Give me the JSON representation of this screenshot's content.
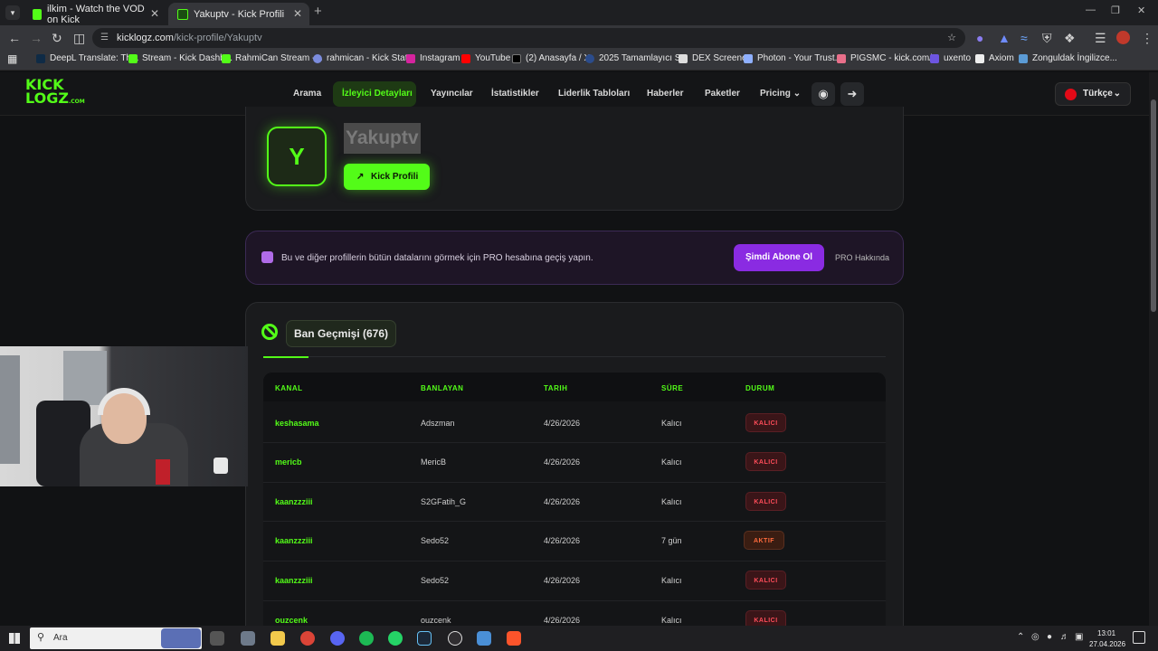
{
  "browser": {
    "tabs": [
      {
        "title": "ilkim - Watch the VOD on Kick",
        "active": false
      },
      {
        "title": "Yakuptv - Kick Profili",
        "active": true
      }
    ],
    "new_tab": "+",
    "url_host": "kicklogz.com",
    "url_path": "/kick-profile/Yakuptv",
    "bookmarks": [
      "DeepL Translate: Th...",
      "Stream - Kick Dashb...",
      "RahmiCan Stream -...",
      "rahmican - Kick Stat...",
      "Instagram",
      "YouTube",
      "(2) Anasayfa / X",
      "2025 Tamamlayıcı S...",
      "DEX Screener",
      "Photon - Your Trust...",
      "PIGSMC - kick.com/...",
      "uxento",
      "Axiom",
      "Zonguldak İngilizce..."
    ]
  },
  "site": {
    "logo_top": "KICK",
    "logo_bottom": "LOGZ",
    "logo_suffix": ".COM",
    "nav": [
      "Arama",
      "İzleyici Detayları",
      "Yayıncılar",
      "İstatistikler",
      "Liderlik Tabloları",
      "Haberler",
      "Paketler",
      "Pricing"
    ],
    "active_nav": "İzleyici Detayları",
    "language": "Türkçe"
  },
  "profile": {
    "initial": "Y",
    "username": "Yakuptv",
    "kick_button": "Kick Profili"
  },
  "pro": {
    "text": "Bu ve diğer profillerin bütün datalarını görmek için PRO hesabına geçiş yapın.",
    "subscribe": "Şimdi Abone Ol",
    "about": "PRO Hakkında"
  },
  "bans": {
    "tab_label": "Ban Geçmişi (676)",
    "headers": [
      "KANAL",
      "BANLAYAN",
      "TARIH",
      "SÜRE",
      "DURUM"
    ],
    "rows": [
      {
        "kanal": "keshasama",
        "banlayan": "Adszman",
        "tarih": "4/26/2026",
        "sure": "Kalıcı",
        "durum": "KALICI"
      },
      {
        "kanal": "mericb",
        "banlayan": "MericB",
        "tarih": "4/26/2026",
        "sure": "Kalıcı",
        "durum": "KALICI"
      },
      {
        "kanal": "kaanzzziii",
        "banlayan": "S2GFatih_G",
        "tarih": "4/26/2026",
        "sure": "Kalıcı",
        "durum": "KALICI"
      },
      {
        "kanal": "kaanzzziii",
        "banlayan": "Sedo52",
        "tarih": "4/26/2026",
        "sure": "7 gün",
        "durum": "AKTIF"
      },
      {
        "kanal": "kaanzzziii",
        "banlayan": "Sedo52",
        "tarih": "4/26/2026",
        "sure": "Kalıcı",
        "durum": "KALICI"
      },
      {
        "kanal": "ouzcenk",
        "banlayan": "ouzcenk",
        "tarih": "4/26/2026",
        "sure": "Kalıcı",
        "durum": "KALICI"
      }
    ]
  },
  "taskbar": {
    "search": "Ara",
    "time": "13:01",
    "date": "27.04.2026"
  },
  "colors": {
    "accent": "#53fc18",
    "purple": "#8a2be2",
    "danger": "#ff4d5a"
  }
}
